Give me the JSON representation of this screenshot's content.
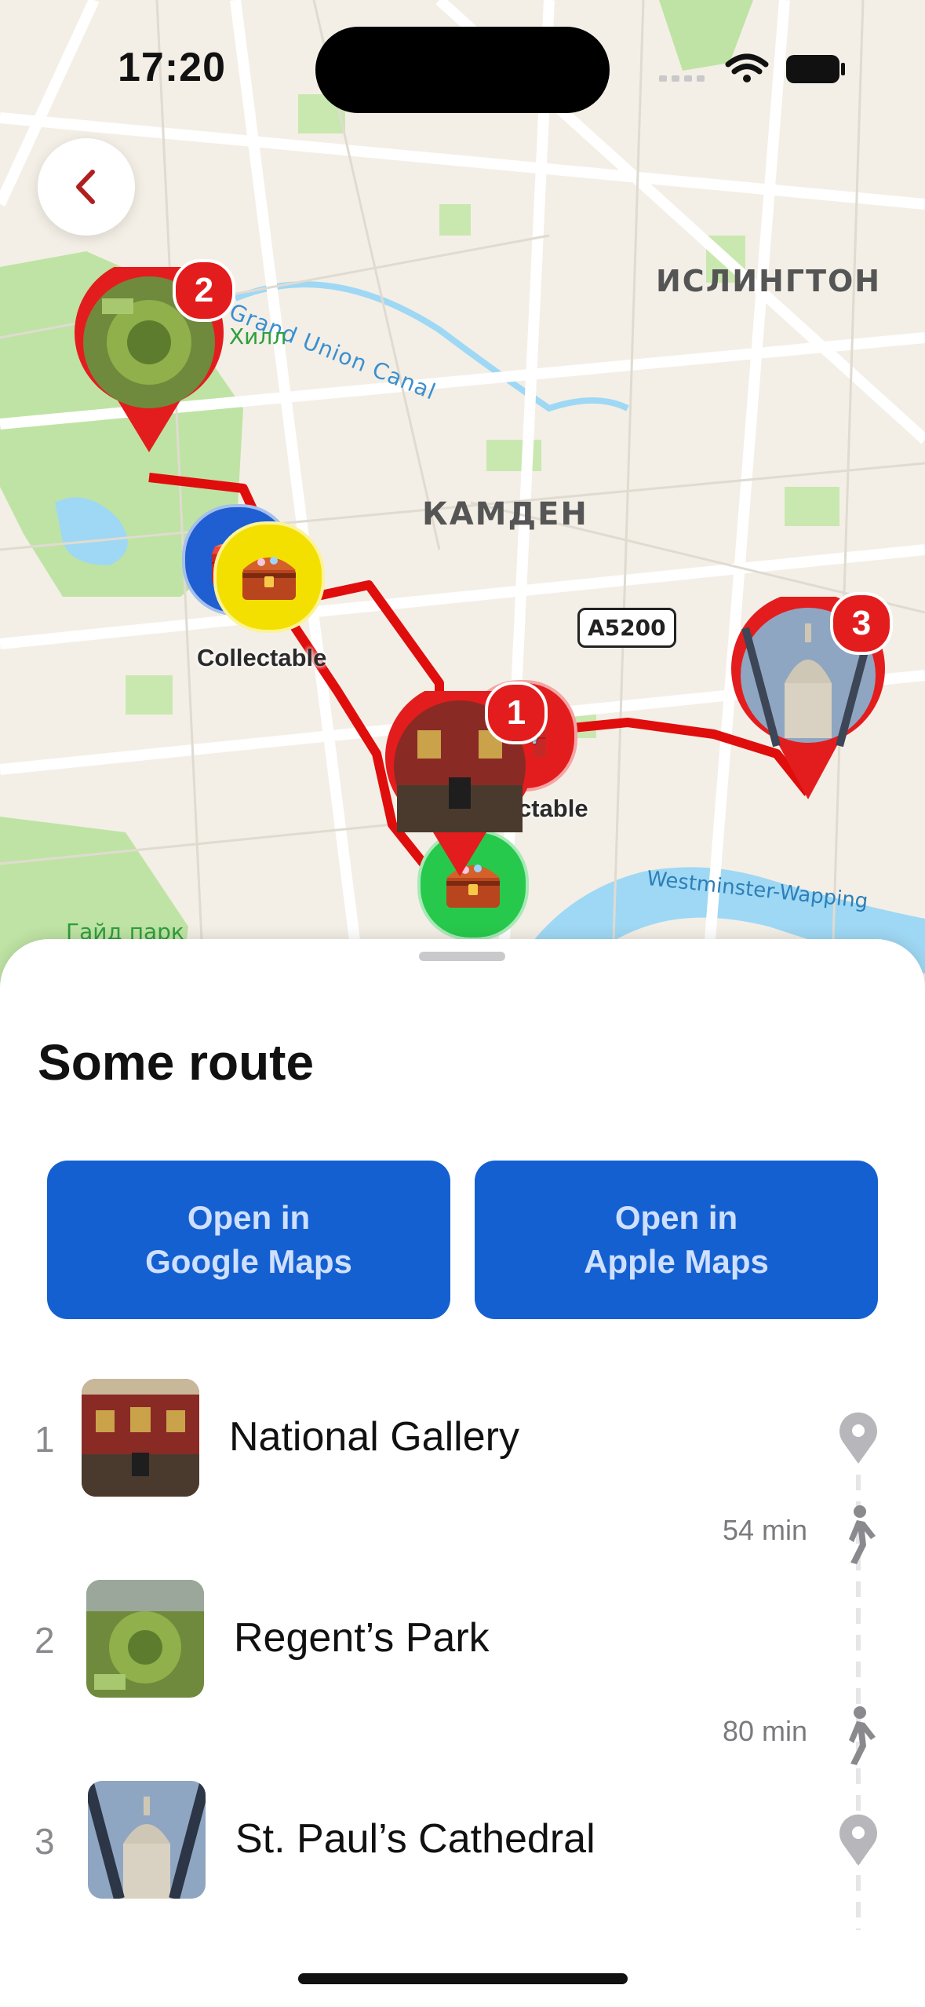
{
  "status_bar": {
    "time": "17:20",
    "icons": [
      "wifi-icon",
      "battery-icon"
    ]
  },
  "map": {
    "back_icon": "chevron-left-icon",
    "labels": {
      "district_1": "ИСЛИНГТОН",
      "district_2": "КАМДЕН",
      "canal": "Grand Union Canal",
      "hill": "Хилл",
      "park": "Гайд парк",
      "river": "Westminster-Wapping",
      "road": "A5200"
    },
    "collectable_label": "Collectable",
    "collectable_partial_label": "ctable",
    "pins": [
      {
        "number": "2",
        "place": "Regent's Park"
      },
      {
        "number": "1",
        "place": "National Gallery"
      },
      {
        "number": "3",
        "place": "St. Paul's Cathedral"
      }
    ],
    "colors": {
      "route": "#e00d0d",
      "pin": "#e31d1d",
      "chest_yellow": "#f4e000",
      "chest_blue": "#1f5fd1",
      "chest_green": "#27c94c",
      "water": "#9fd8f4",
      "park": "#bfe3a4"
    }
  },
  "sheet": {
    "title": "Some route",
    "buttons": {
      "google": {
        "line1": "Open in",
        "line2": "Google Maps"
      },
      "apple": {
        "line1": "Open in",
        "line2": "Apple Maps"
      }
    },
    "places": [
      {
        "index": "1",
        "name": "National Gallery"
      },
      {
        "index": "2",
        "name": "Regent’s Park"
      },
      {
        "index": "3",
        "name": "St. Paul’s Cathedral"
      }
    ],
    "walks": [
      {
        "time": "54 min"
      },
      {
        "time": "80 min"
      }
    ],
    "colors": {
      "button": "#1560d1",
      "button_text": "#cfe0ff"
    }
  }
}
